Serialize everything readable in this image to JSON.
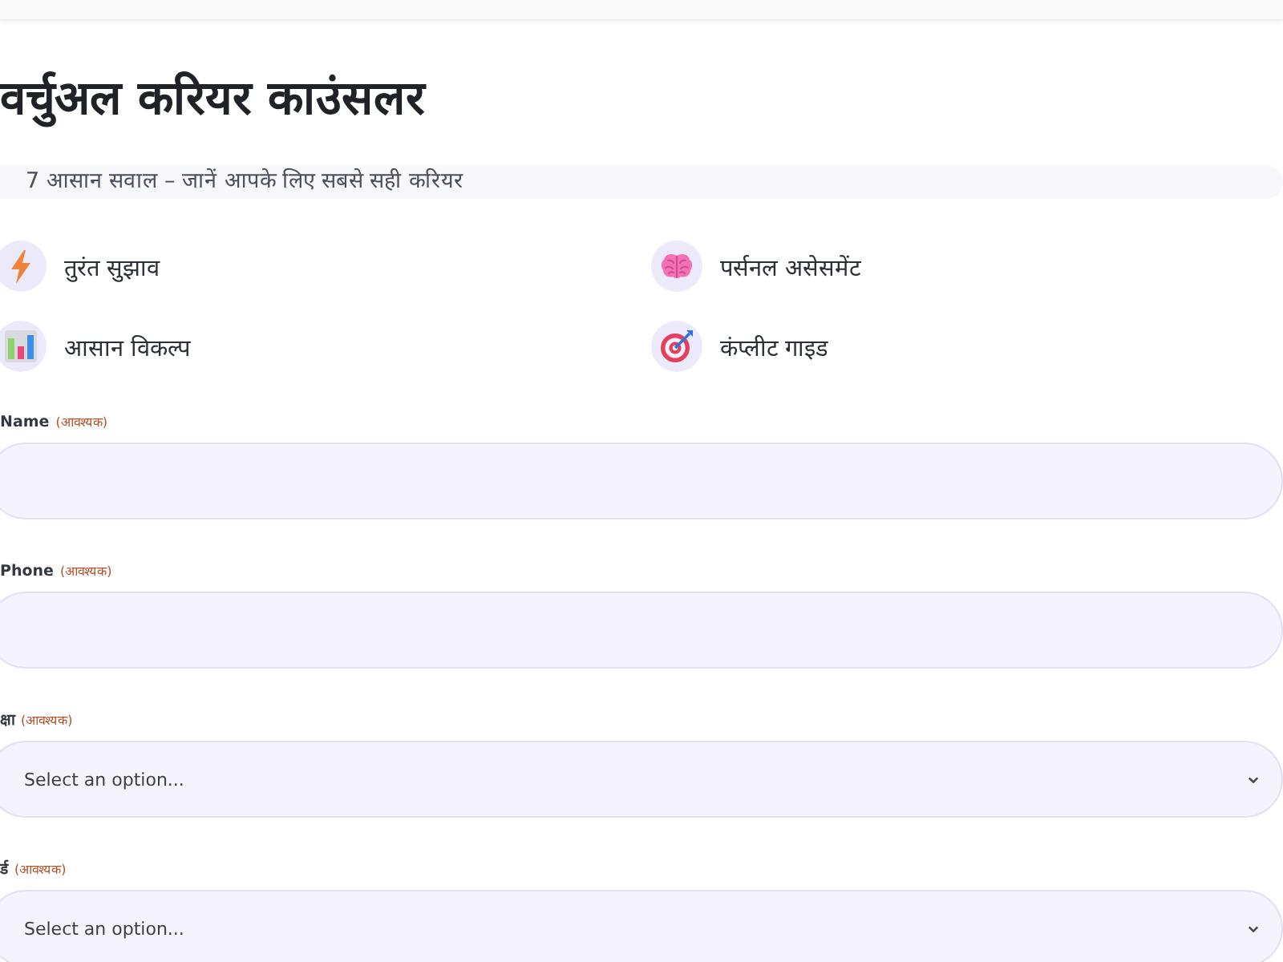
{
  "title": "वर्चुअल करियर काउंसलर",
  "subtitle": "7 आसान सवाल – जानें आपके लिए सबसे सही करियर",
  "features": [
    {
      "label": "तुरंत सुझाव"
    },
    {
      "label": "पर्सनल असेसमेंट"
    },
    {
      "label": "आसान विकल्प"
    },
    {
      "label": "कंप्लीट गाइड"
    }
  ],
  "fields": [
    {
      "kind": "text",
      "label": "Name",
      "note": "(आवश्यक)"
    },
    {
      "kind": "text",
      "label": "Phone",
      "note": "(आवश्यक)"
    },
    {
      "kind": "select",
      "label": "क्षा",
      "note": "(आवश्यक)",
      "placeholder": "Select an option..."
    },
    {
      "kind": "select",
      "label": "र्ड",
      "note": "(आवश्यक)",
      "placeholder": "Select an option..."
    }
  ]
}
